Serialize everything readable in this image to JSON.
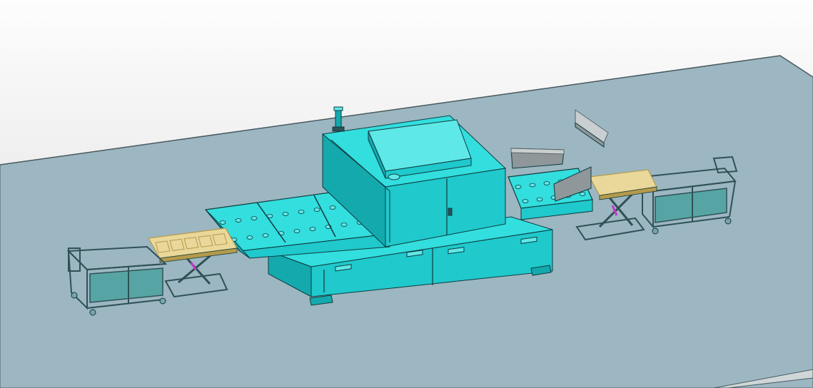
{
  "viewport": {
    "background_top": "#fdfdfd",
    "background_bottom": "#dcdcdc"
  },
  "colors": {
    "floor": "#9cb7c1",
    "floor_edge": "#4a5a60",
    "floor_side": "#cfd6d8",
    "cyan_top": "#33dede",
    "cyan_front": "#1fc9cc",
    "cyan_side": "#14a9ad",
    "cyan_light": "#5fe8e8",
    "outline": "#0e3b3f",
    "rail": "#7aa3aa",
    "rail_dark": "#2f5156",
    "mesh": "#3f9f9a",
    "tray": "#e9d89a",
    "tray_dark": "#b59a4c",
    "panel_gray": "#8f979a",
    "panel_dark": "#5c6466",
    "accent_magenta": "#cc33cc"
  },
  "scene": {
    "objects": [
      "floor-plane",
      "main-machine-cabinet",
      "left-conveyor",
      "right-conveyor",
      "left-lift-table",
      "right-lift-table",
      "left-cart",
      "right-cart",
      "signal-light-tower",
      "floating-hood-part",
      "floating-guard-plate"
    ]
  }
}
